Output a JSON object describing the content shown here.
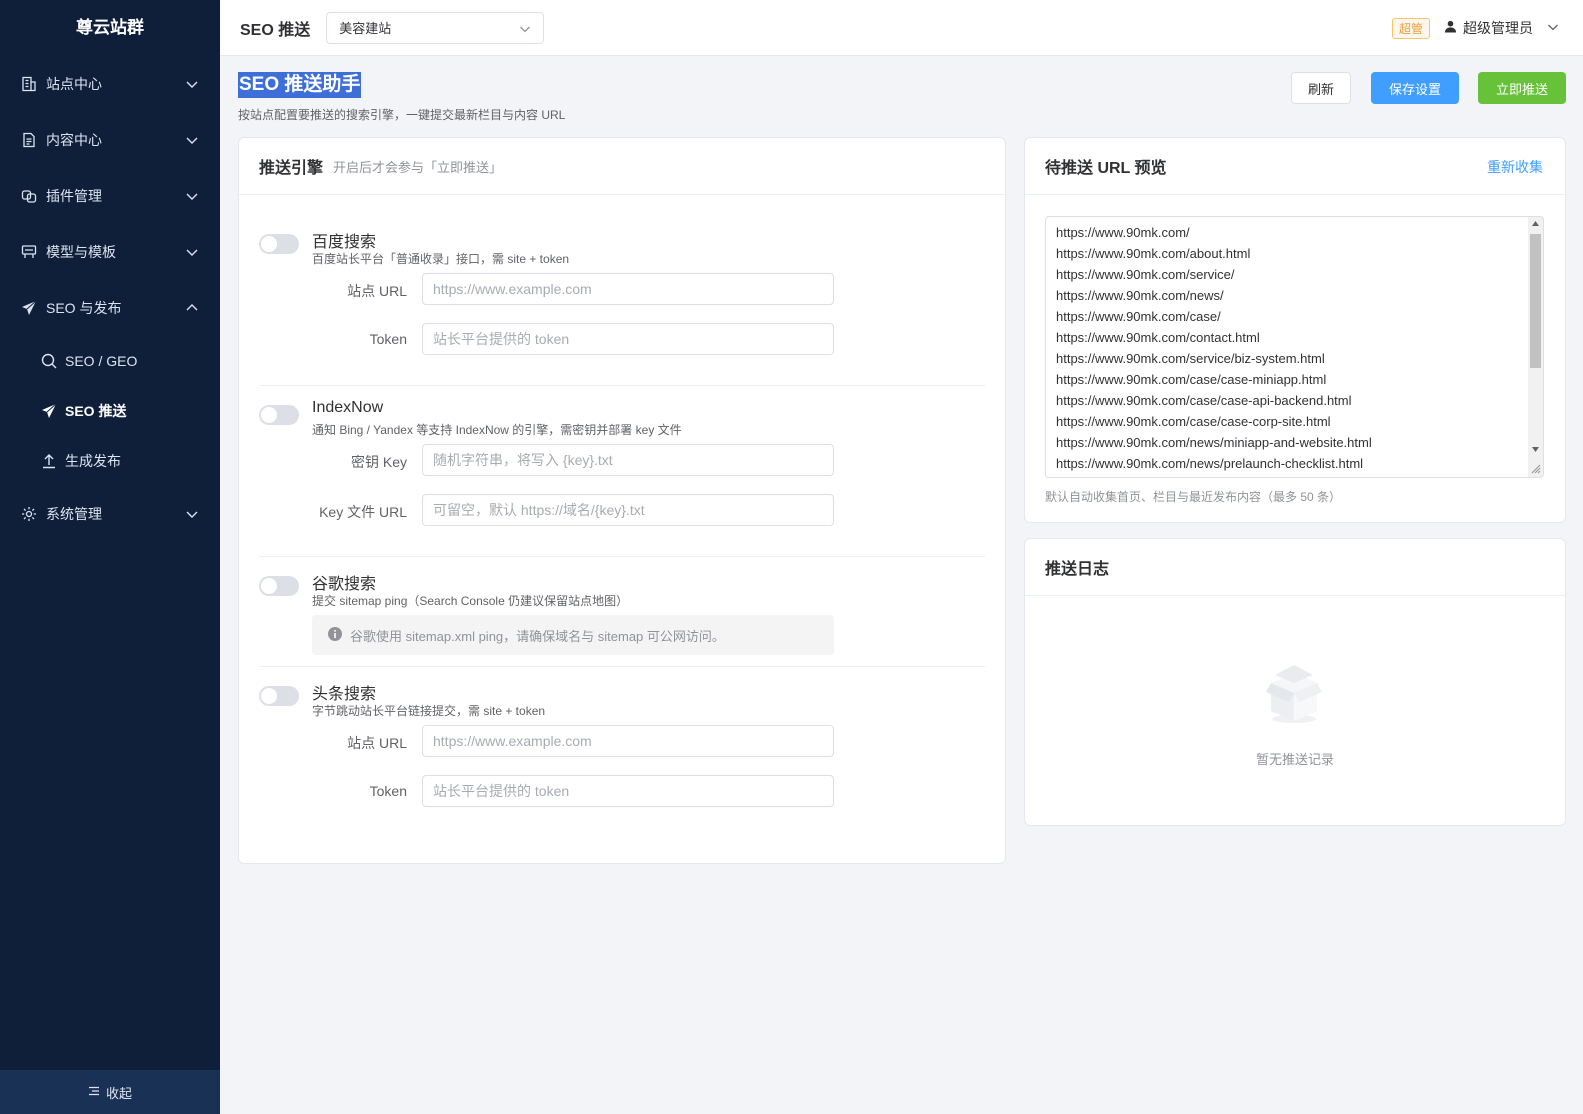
{
  "sidebar": {
    "logo": "尊云站群",
    "menu": [
      {
        "label": "站点中心",
        "icon": "building-icon"
      },
      {
        "label": "内容中心",
        "icon": "document-icon"
      },
      {
        "label": "插件管理",
        "icon": "plugin-icon"
      },
      {
        "label": "模型与模板",
        "icon": "template-icon"
      },
      {
        "label": "SEO 与发布",
        "icon": "send-icon"
      },
      {
        "label": "系统管理",
        "icon": "gear-icon"
      }
    ],
    "submenu": [
      {
        "label": "SEO / GEO",
        "icon": "search-icon"
      },
      {
        "label": "SEO 推送",
        "icon": "send-icon"
      },
      {
        "label": "生成发布",
        "icon": "upload-icon"
      }
    ],
    "collapse_label": "收起"
  },
  "header": {
    "title": "SEO 推送",
    "site_select": "美容建站",
    "role_badge": "超管",
    "user_name": "超级管理员"
  },
  "page": {
    "title": "SEO 推送助手",
    "description": "按站点配置要推送的搜索引擎，一键提交最新栏目与内容 URL",
    "buttons": {
      "refresh": "刷新",
      "save": "保存设置",
      "push": "立即推送"
    }
  },
  "engines": {
    "title": "推送引擎",
    "subtitle": "开启后才会参与「立即推送」",
    "baidu": {
      "name": "百度搜索",
      "desc": "百度站长平台「普通收录」接口，需 site + token",
      "enabled": false,
      "site_label": "站点 URL",
      "site_placeholder": "https://www.example.com",
      "token_label": "Token",
      "token_placeholder": "站长平台提供的 token"
    },
    "indexnow": {
      "name": "IndexNow",
      "desc": "通知 Bing / Yandex 等支持 IndexNow 的引擎，需密钥并部署 key 文件",
      "enabled": false,
      "key_label": "密钥 Key",
      "key_placeholder": "随机字符串，将写入 {key}.txt",
      "keyurl_label": "Key 文件 URL",
      "keyurl_placeholder": "可留空，默认 https://域名/{key}.txt"
    },
    "google": {
      "name": "谷歌搜索",
      "desc": "提交 sitemap ping（Search Console 仍建议保留站点地图）",
      "enabled": false,
      "notice": "谷歌使用 sitemap.xml ping，请确保域名与 sitemap 可公网访问。"
    },
    "toutiao": {
      "name": "头条搜索",
      "desc": "字节跳动站长平台链接提交，需 site + token",
      "enabled": false,
      "site_label": "站点 URL",
      "site_placeholder": "https://www.example.com",
      "token_label": "Token",
      "token_placeholder": "站长平台提供的 token"
    }
  },
  "url_preview": {
    "title": "待推送 URL 预览",
    "recollect": "重新收集",
    "urls": [
      "https://www.90mk.com/",
      "https://www.90mk.com/about.html",
      "https://www.90mk.com/service/",
      "https://www.90mk.com/news/",
      "https://www.90mk.com/case/",
      "https://www.90mk.com/contact.html",
      "https://www.90mk.com/service/biz-system.html",
      "https://www.90mk.com/case/case-miniapp.html",
      "https://www.90mk.com/case/case-api-backend.html",
      "https://www.90mk.com/case/case-corp-site.html",
      "https://www.90mk.com/news/miniapp-and-website.html",
      "https://www.90mk.com/news/prelaunch-checklist.html"
    ],
    "hint": "默认自动收集首页、栏目与最近发布内容（最多 50 条）"
  },
  "log": {
    "title": "推送日志",
    "empty_text": "暂无推送记录"
  },
  "colors": {
    "sidebar_bg": "#0f1f3a",
    "primary": "#409eff",
    "success": "#67c23a",
    "warning": "#e6a23c"
  }
}
